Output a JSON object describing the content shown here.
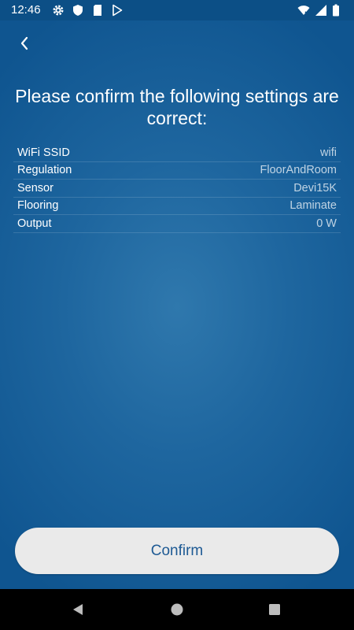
{
  "status_bar": {
    "time": "12:46",
    "icons_left": [
      "gear-icon",
      "shield-icon",
      "sd-card-icon",
      "play-store-icon"
    ],
    "icons_right": [
      "wifi-icon",
      "signal-icon",
      "battery-icon"
    ]
  },
  "header": {
    "back_icon": "chevron-left-icon",
    "title": "Please confirm the following settings are correct:"
  },
  "settings": [
    {
      "label": "WiFi SSID",
      "value": "wifi"
    },
    {
      "label": "Regulation",
      "value": "FloorAndRoom"
    },
    {
      "label": "Sensor",
      "value": "Devi15K"
    },
    {
      "label": "Flooring",
      "value": "Laminate"
    },
    {
      "label": "Output",
      "value": "0 W"
    }
  ],
  "actions": {
    "confirm_label": "Confirm"
  },
  "nav_bar": {
    "icons": [
      "nav-back-icon",
      "nav-home-icon",
      "nav-recents-icon"
    ]
  },
  "colors": {
    "background": "#1e669f",
    "status_bar": "#0c4f86",
    "button_bg": "#eaeaea",
    "button_text": "#1e5a94"
  }
}
